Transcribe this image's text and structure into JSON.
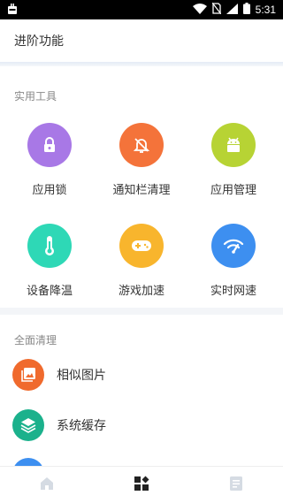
{
  "status_bar": {
    "time": "5:31"
  },
  "header": {
    "title": "进阶功能"
  },
  "tools_section": {
    "title": "实用工具",
    "items": [
      {
        "label": "应用锁",
        "icon": "lock-icon",
        "color": "#a878e6"
      },
      {
        "label": "通知栏清理",
        "icon": "bell-off-icon",
        "color": "#f4733a"
      },
      {
        "label": "应用管理",
        "icon": "android-icon",
        "color": "#b7d334"
      },
      {
        "label": "设备降温",
        "icon": "thermometer-icon",
        "color": "#2ed8b6"
      },
      {
        "label": "游戏加速",
        "icon": "gamepad-icon",
        "color": "#f8b52d"
      },
      {
        "label": "实时网速",
        "icon": "wifi-speed-icon",
        "color": "#3d8ff0"
      }
    ]
  },
  "clean_section": {
    "title": "全面清理",
    "items": [
      {
        "label": "相似图片",
        "icon": "photos-icon",
        "color": "#f06a2d"
      },
      {
        "label": "系统缓存",
        "icon": "layers-icon",
        "color": "#1bb18c"
      }
    ]
  },
  "bottom_nav": {
    "items": [
      {
        "name": "home",
        "icon": "home-icon",
        "active": false
      },
      {
        "name": "features",
        "icon": "grid-icon",
        "active": true
      },
      {
        "name": "list",
        "icon": "document-icon",
        "active": false
      }
    ]
  }
}
